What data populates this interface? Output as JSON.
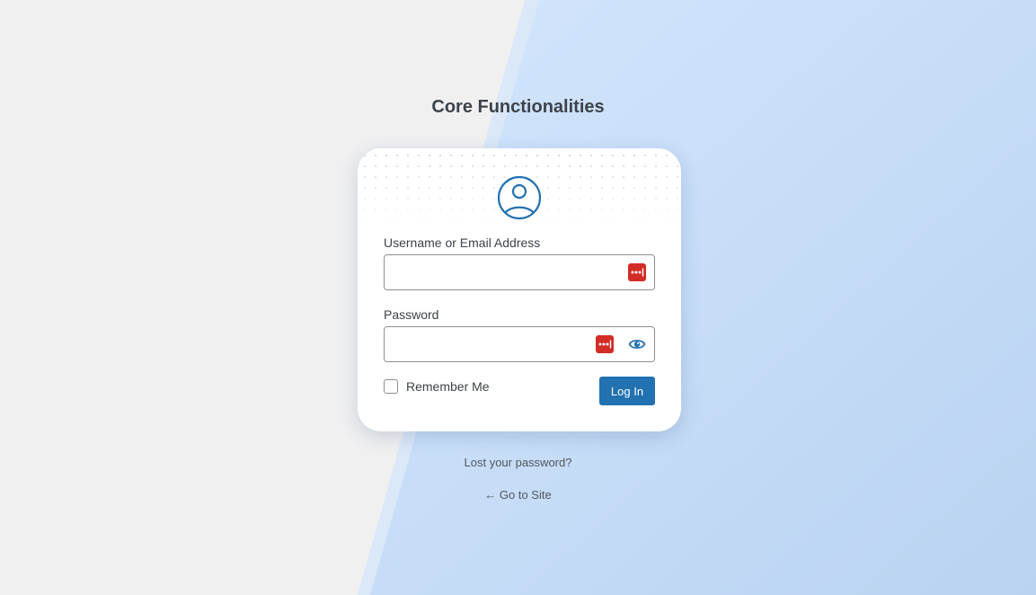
{
  "site": {
    "title": "Core Functionalities"
  },
  "form": {
    "username_label": "Username or Email Address",
    "username_value": "",
    "password_label": "Password",
    "password_value": "",
    "remember_label": "Remember Me",
    "remember_checked": false,
    "submit_label": "Log In"
  },
  "links": {
    "lost_password": "Lost your password?",
    "back_to_site": "← Go to Site"
  },
  "icons": {
    "user": "user-circle-icon",
    "password_manager": "lastpass-icon",
    "show_password": "eye-icon"
  },
  "colors": {
    "page_background": "#f0f0f1",
    "accent_gradient_start": "#d4e6fd",
    "accent_gradient_end": "#b9d3f1",
    "primary_button": "#2271b1",
    "password_manager_red": "#d32d27",
    "title_text": "#3c434a"
  }
}
